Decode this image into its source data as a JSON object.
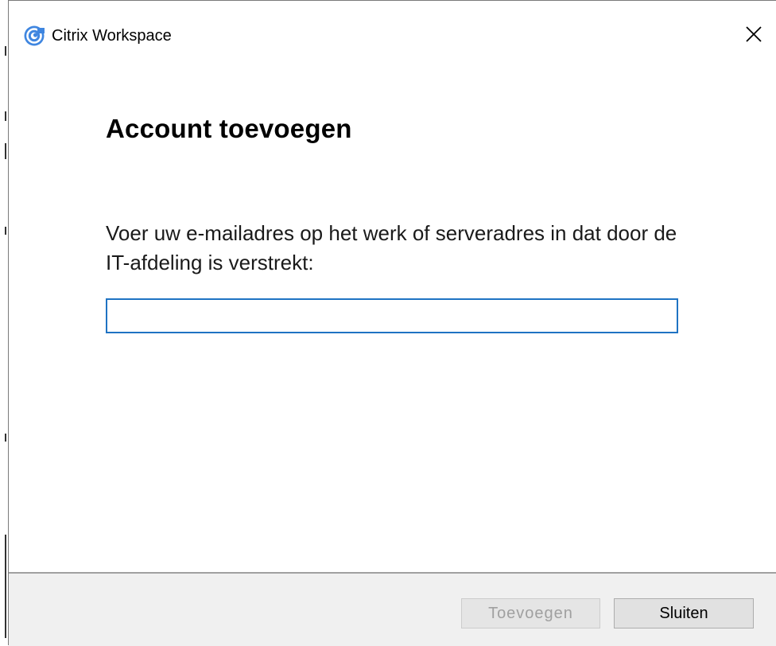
{
  "window": {
    "title": "Citrix Workspace",
    "close_icon": "close-icon",
    "app_icon": "citrix-logo-icon"
  },
  "dialog": {
    "heading": "Account toevoegen",
    "instruction": "Voer uw e-mailadres op het werk of serveradres in dat door de IT-afdeling is verstrekt:",
    "address_input": {
      "value": "",
      "placeholder": ""
    }
  },
  "footer": {
    "add_label": "Toevoegen",
    "add_enabled": false,
    "close_label": "Sluiten"
  },
  "colors": {
    "input_border": "#1f73c3",
    "footer_bg": "#f0f0f0",
    "disabled_text": "#a0a0a0"
  }
}
